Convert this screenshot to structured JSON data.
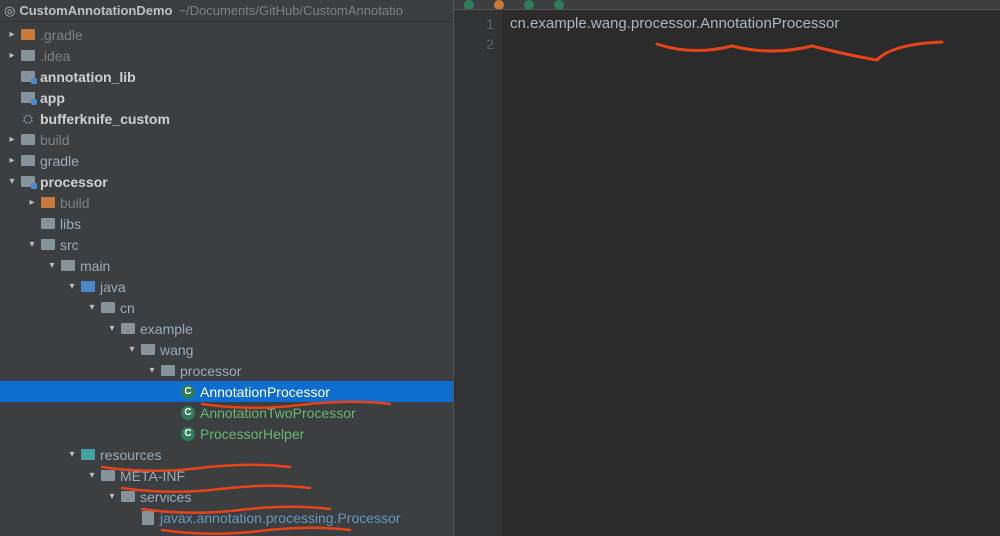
{
  "project": {
    "name": "CustomAnnotationDemo",
    "path": "~/Documents/GitHub/CustomAnnotatio"
  },
  "tree": [
    {
      "d": 0,
      "arrow": "closed",
      "icon": "folder-orange",
      "label": ".gradle",
      "style": "grey"
    },
    {
      "d": 0,
      "arrow": "closed",
      "icon": "folder-grey",
      "label": ".idea",
      "style": "grey"
    },
    {
      "d": 0,
      "arrow": "none",
      "icon": "module",
      "label": "annotation_lib",
      "style": "bold"
    },
    {
      "d": 0,
      "arrow": "none",
      "icon": "module",
      "label": "app",
      "style": "bold"
    },
    {
      "d": 0,
      "arrow": "none",
      "icon": "elephant",
      "label": "bufferknife_custom",
      "style": "bold"
    },
    {
      "d": 0,
      "arrow": "closed",
      "icon": "folder-grey",
      "label": "build",
      "style": "grey"
    },
    {
      "d": 0,
      "arrow": "closed",
      "icon": "folder-grey",
      "label": "gradle",
      "style": "file"
    },
    {
      "d": 0,
      "arrow": "open",
      "icon": "module",
      "label": "processor",
      "style": "bold"
    },
    {
      "d": 1,
      "arrow": "closed",
      "icon": "folder-orange",
      "label": "build",
      "style": "grey"
    },
    {
      "d": 1,
      "arrow": "none",
      "icon": "folder-grey",
      "label": "libs",
      "style": "file"
    },
    {
      "d": 1,
      "arrow": "open",
      "icon": "folder-grey",
      "label": "src",
      "style": "file"
    },
    {
      "d": 2,
      "arrow": "open",
      "icon": "folder-grey",
      "label": "main",
      "style": "file"
    },
    {
      "d": 3,
      "arrow": "open",
      "icon": "folder-blue",
      "label": "java",
      "style": "file"
    },
    {
      "d": 4,
      "arrow": "open",
      "icon": "folder-grey",
      "label": "cn",
      "style": "file"
    },
    {
      "d": 5,
      "arrow": "open",
      "icon": "folder-grey",
      "label": "example",
      "style": "file"
    },
    {
      "d": 6,
      "arrow": "open",
      "icon": "folder-grey",
      "label": "wang",
      "style": "file"
    },
    {
      "d": 7,
      "arrow": "open",
      "icon": "folder-grey",
      "label": "processor",
      "style": "file"
    },
    {
      "d": 8,
      "arrow": "none",
      "icon": "class",
      "label": "AnnotationProcessor",
      "style": "file",
      "selected": true,
      "mark": true
    },
    {
      "d": 8,
      "arrow": "none",
      "icon": "class",
      "label": "AnnotationTwoProcessor",
      "style": "green"
    },
    {
      "d": 8,
      "arrow": "none",
      "icon": "class",
      "label": "ProcessorHelper",
      "style": "green"
    },
    {
      "d": 3,
      "arrow": "open",
      "icon": "folder-teal",
      "label": "resources",
      "style": "file",
      "mark": true
    },
    {
      "d": 4,
      "arrow": "open",
      "icon": "folder-grey",
      "label": "META-INF",
      "style": "file",
      "mark": true
    },
    {
      "d": 5,
      "arrow": "open",
      "icon": "folder-grey",
      "label": "services",
      "style": "file",
      "mark": true
    },
    {
      "d": 6,
      "arrow": "none",
      "icon": "textfile",
      "label": "javax.annotation.processing.Processor",
      "style": "blue",
      "mark": true
    }
  ],
  "editor": {
    "lines": [
      "cn.example.wang.processor.AnnotationProcessor",
      ""
    ],
    "numbers": [
      "1",
      "2"
    ]
  }
}
